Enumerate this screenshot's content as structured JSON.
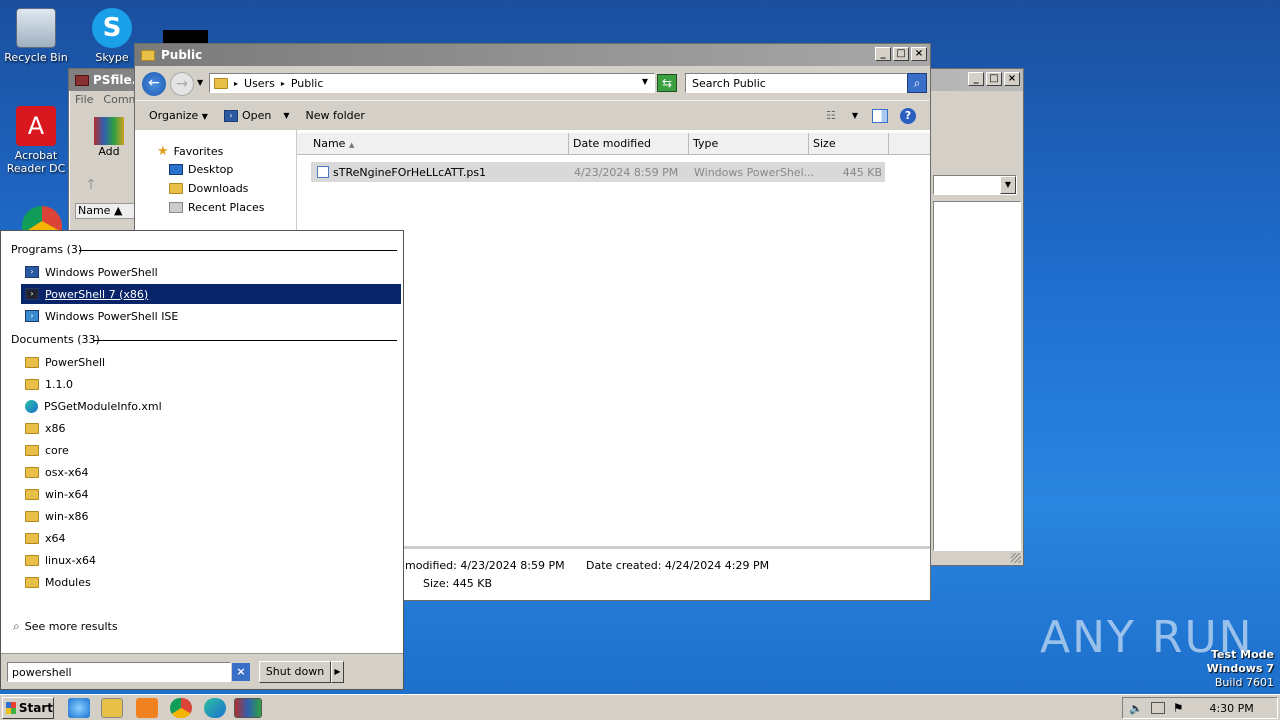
{
  "desktop": {
    "icons": [
      {
        "label": "Recycle Bin"
      },
      {
        "label": "Skype"
      },
      {
        "label": "Acrobat Reader DC"
      }
    ],
    "watermark": "ANY RUN",
    "test_mode": {
      "line1": "Test Mode",
      "line2": "Windows 7",
      "line3": "Build 7601"
    }
  },
  "bg_window": {
    "title": "PSfile.zi",
    "menu": [
      "File",
      "Comm"
    ],
    "add_label": "Add",
    "col_name": "Name"
  },
  "explorer": {
    "title": "Public",
    "breadcrumb": [
      "Users",
      "Public"
    ],
    "search_placeholder": "Search Public",
    "toolbar": {
      "organize": "Organize",
      "open": "Open",
      "new_folder": "New folder"
    },
    "nav": {
      "favorites": "Favorites",
      "items": [
        "Desktop",
        "Downloads",
        "Recent Places"
      ]
    },
    "columns": [
      "Name",
      "Date modified",
      "Type",
      "Size"
    ],
    "file": {
      "name": "sTReNgineFOrHeLLcATT.ps1",
      "date": "4/23/2024 8:59 PM",
      "type": "Windows PowerShel...",
      "size": "445 KB"
    },
    "details": {
      "modified": "modified: 4/23/2024 8:59 PM",
      "created": "Date created: 4/24/2024 4:29 PM",
      "size": "Size: 445 KB"
    }
  },
  "start_menu": {
    "programs_header": "Programs (3)",
    "programs": [
      "Windows PowerShell",
      "PowerShell 7 (x86)",
      "Windows PowerShell ISE"
    ],
    "documents_header": "Documents (33)",
    "documents": [
      "PowerShell",
      "1.1.0",
      "PSGetModuleInfo.xml",
      "x86",
      "core",
      "osx-x64",
      "win-x64",
      "win-x86",
      "x64",
      "linux-x64",
      "Modules"
    ],
    "see_more": "See more results",
    "search_value": "powershell",
    "shutdown": "Shut down"
  },
  "taskbar": {
    "start": "Start",
    "clock": "4:30 PM"
  }
}
